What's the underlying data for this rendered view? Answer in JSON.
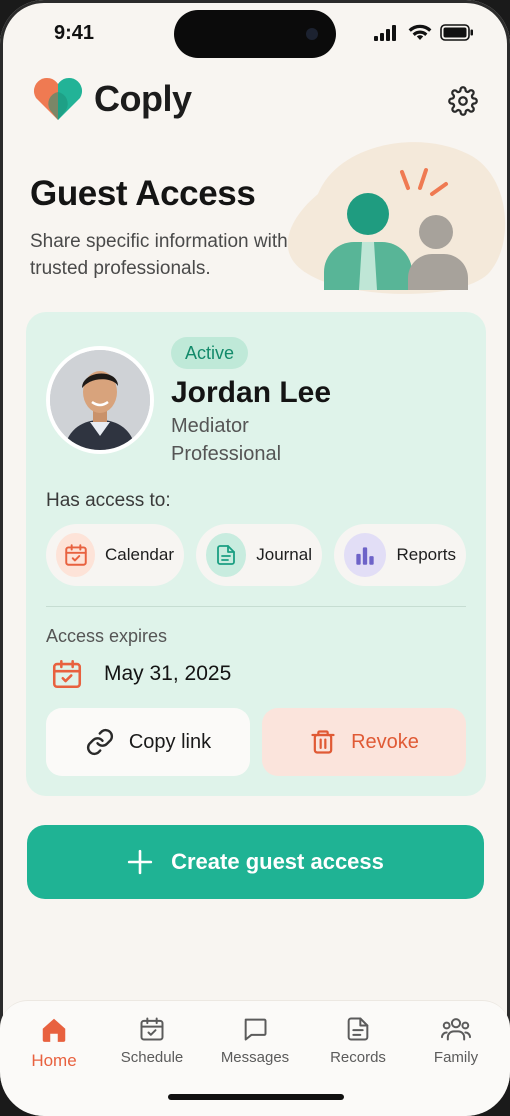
{
  "status_bar": {
    "time": "9:41"
  },
  "header": {
    "brand": "Coply",
    "logo_icon": "heart-logo-icon",
    "settings_icon": "gear-icon"
  },
  "hero": {
    "title": "Guest Access",
    "subtitle": "Share specific information with trusted professionals."
  },
  "guest": {
    "status": "Active",
    "name": "Jordan Lee",
    "role": "Mediator Professional",
    "access_label": "Has access to:",
    "access": [
      {
        "label": "Calendar",
        "icon": "calendar-check-icon",
        "color": "#e8613f"
      },
      {
        "label": "Journal",
        "icon": "document-icon",
        "color": "#1a9f82"
      },
      {
        "label": "Reports",
        "icon": "bar-chart-icon",
        "color": "#6d63c8"
      }
    ],
    "expires_label": "Access expires",
    "expires_date": "May 31, 2025",
    "copy_label": "Copy link",
    "revoke_label": "Revoke"
  },
  "create_button": {
    "label": "Create guest access"
  },
  "tabbar": {
    "tabs": [
      {
        "label": "Home",
        "icon": "home-icon",
        "active": true
      },
      {
        "label": "Schedule",
        "icon": "calendar-check-icon",
        "active": false
      },
      {
        "label": "Messages",
        "icon": "chat-bubble-icon",
        "active": false
      },
      {
        "label": "Records",
        "icon": "document-icon",
        "active": false
      },
      {
        "label": "Family",
        "icon": "people-icon",
        "active": false
      }
    ]
  },
  "colors": {
    "accent": "#1fb394",
    "danger": "#e05a35",
    "active_tab": "#e8613f",
    "background": "#f8f5f1",
    "card": "#dff3ea"
  }
}
